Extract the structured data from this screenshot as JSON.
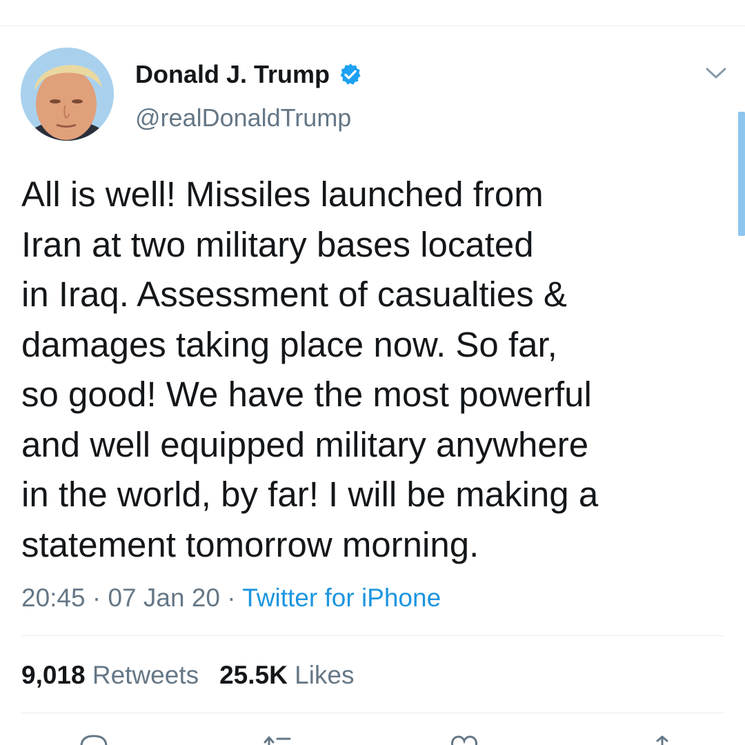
{
  "author": {
    "display_name": "Donald J. Trump",
    "handle": "@realDonaldTrump",
    "verified": true,
    "verified_icon": "verified-badge-icon",
    "avatar": "profile-photo"
  },
  "tweet": {
    "lines": [
      "All is well! Missiles launched from",
      "Iran at two military bases located",
      "in Iraq. Assessment of casualties &",
      "damages taking place now. So far,",
      "so good! We have the most powerful",
      "and well equipped military anywhere",
      "in the world, by far! I will be making a",
      "statement tomorrow morning."
    ]
  },
  "meta": {
    "time": "20:45",
    "separator": "·",
    "date": "07 Jan 20",
    "source": "Twitter for iPhone"
  },
  "stats": {
    "retweets_count": "9,018",
    "retweets_label": "Retweets",
    "likes_count": "25.5K",
    "likes_label": "Likes"
  },
  "actions": [
    "reply-icon",
    "retweet-icon",
    "like-icon",
    "share-icon"
  ],
  "colors": {
    "text": "#14171a",
    "secondary": "#657786",
    "link": "#1b95e0",
    "divider": "#e6ecf0",
    "verified": "#1da1f2"
  }
}
